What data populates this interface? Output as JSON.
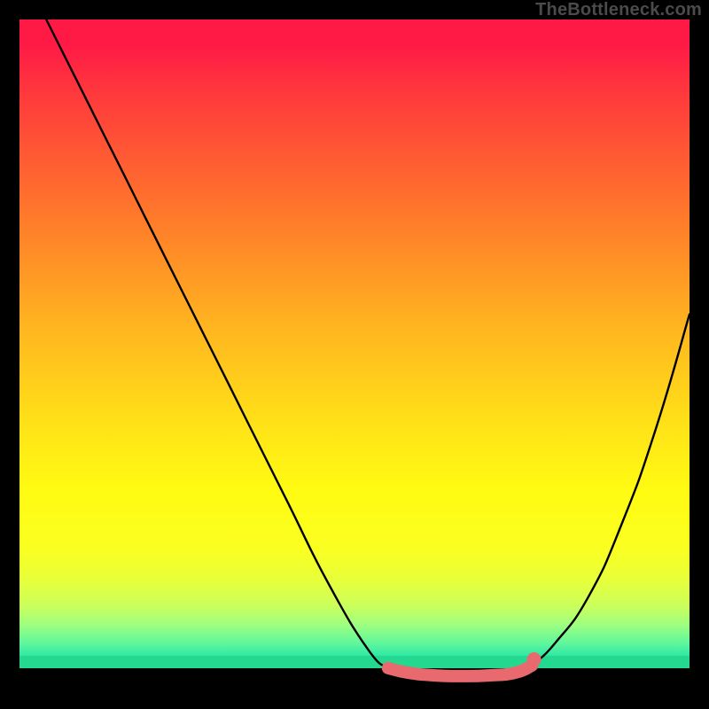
{
  "watermark": "TheBottleneck.com",
  "chart_data": {
    "type": "line",
    "title": "",
    "xlabel": "",
    "ylabel": "",
    "series": [
      {
        "name": "curve-left",
        "x": [
          0.04,
          0.1,
          0.16,
          0.22,
          0.28,
          0.34,
          0.4,
          0.46,
          0.52,
          0.55
        ],
        "y": [
          0.0,
          0.12,
          0.24,
          0.36,
          0.48,
          0.6,
          0.72,
          0.84,
          0.94,
          0.968
        ]
      },
      {
        "name": "curve-right",
        "x": [
          0.765,
          0.8,
          0.85,
          0.9,
          0.95,
          1.0
        ],
        "y": [
          0.964,
          0.93,
          0.86,
          0.75,
          0.61,
          0.44
        ]
      },
      {
        "name": "flat-bottom",
        "x": [
          0.55,
          0.58,
          0.62,
          0.66,
          0.7,
          0.74,
          0.765
        ],
        "y": [
          0.968,
          0.975,
          0.979,
          0.98,
          0.979,
          0.975,
          0.964
        ]
      }
    ],
    "markers": [
      {
        "x": 0.768,
        "y": 0.955
      }
    ],
    "xlim": [
      0,
      1
    ],
    "ylim": [
      0,
      1
    ],
    "note": "x,y are fractional positions within the plot area; y increases downward"
  }
}
